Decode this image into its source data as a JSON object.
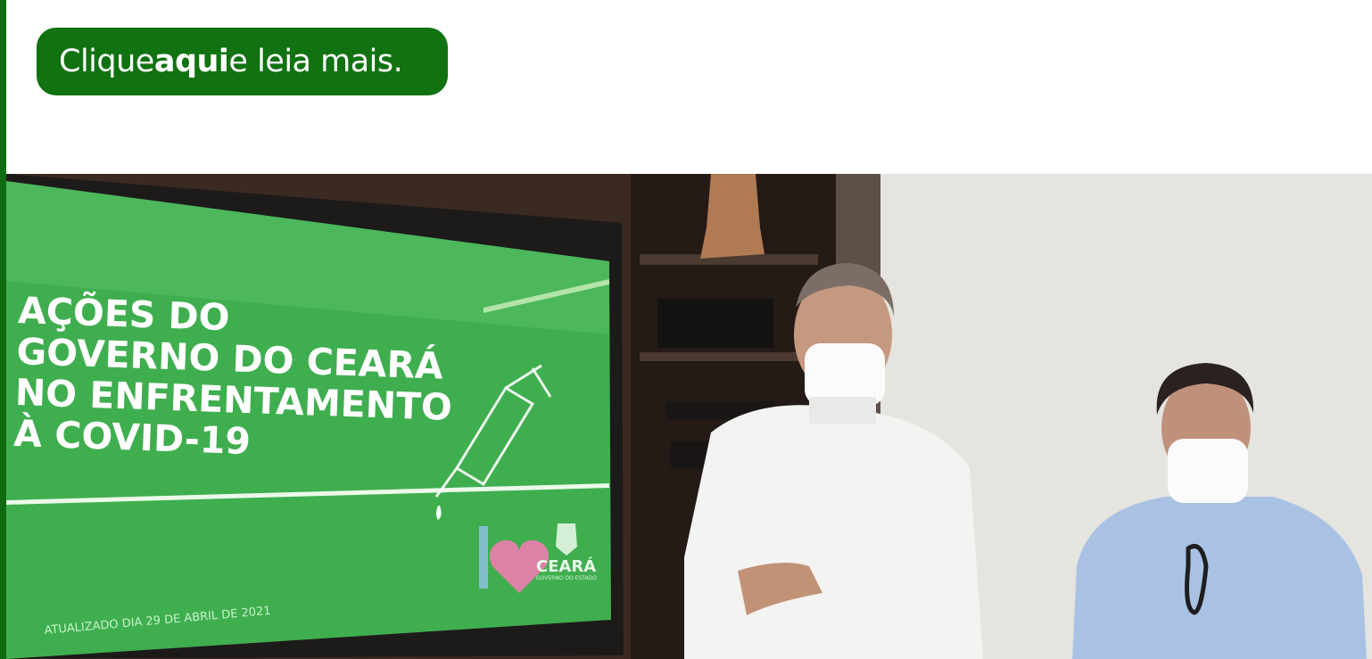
{
  "cta": {
    "prefix": "Clique ",
    "bold": "aqui",
    "suffix": " e leia mais."
  },
  "photo": {
    "screen": {
      "headline_lines": [
        "AÇÕES DO",
        "GOVERNO DO CEARÁ",
        "NO ENFRENTAMENTO",
        "À COVID-19"
      ],
      "updated": "ATUALIZADO DIA 29 DE ABRIL DE 2021",
      "brand": "CEARÁ",
      "brand_sub": "GOVERNO DO ESTADO"
    }
  },
  "colors": {
    "accent": "#117211",
    "screen_green": "#3fae4f",
    "white": "#ffffff"
  }
}
